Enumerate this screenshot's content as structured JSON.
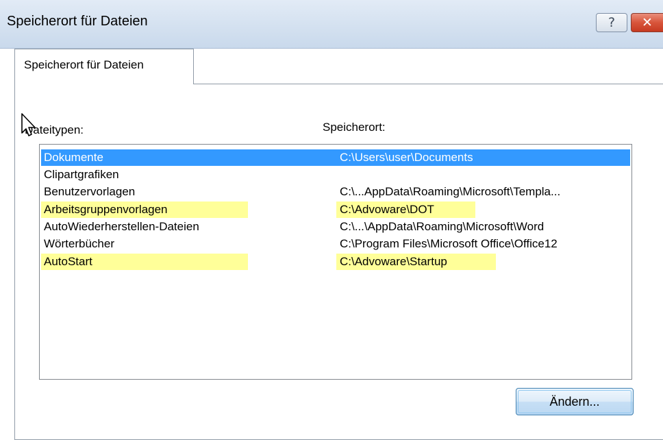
{
  "window": {
    "title": "Speicherort für Dateien",
    "help_label": "?",
    "close_label": "✕"
  },
  "tab": {
    "label": "Speicherort für Dateien"
  },
  "columns": {
    "filetype": "Dateitypen:",
    "location": "Speicherort:"
  },
  "rows": [
    {
      "type": "Dokumente",
      "path": "C:\\Users\\user\\Documents"
    },
    {
      "type": "Clipartgrafiken",
      "path": ""
    },
    {
      "type": "Benutzervorlagen",
      "path": "C:\\...AppData\\Roaming\\Microsoft\\Templa..."
    },
    {
      "type": "Arbeitsgruppenvorlagen",
      "path": "C:\\Advoware\\DOT"
    },
    {
      "type": "AutoWiederherstellen-Dateien",
      "path": "C:\\...\\AppData\\Roaming\\Microsoft\\Word"
    },
    {
      "type": "Wörterbücher",
      "path": "C:\\Program Files\\Microsoft Office\\Office12"
    },
    {
      "type": "AutoStart",
      "path": "C:\\Advoware\\Startup"
    }
  ],
  "buttons": {
    "change": "Ändern..."
  },
  "colors": {
    "selection": "#3399ff",
    "highlight": "#ffff99",
    "titlebar": "#d4e1f0"
  }
}
